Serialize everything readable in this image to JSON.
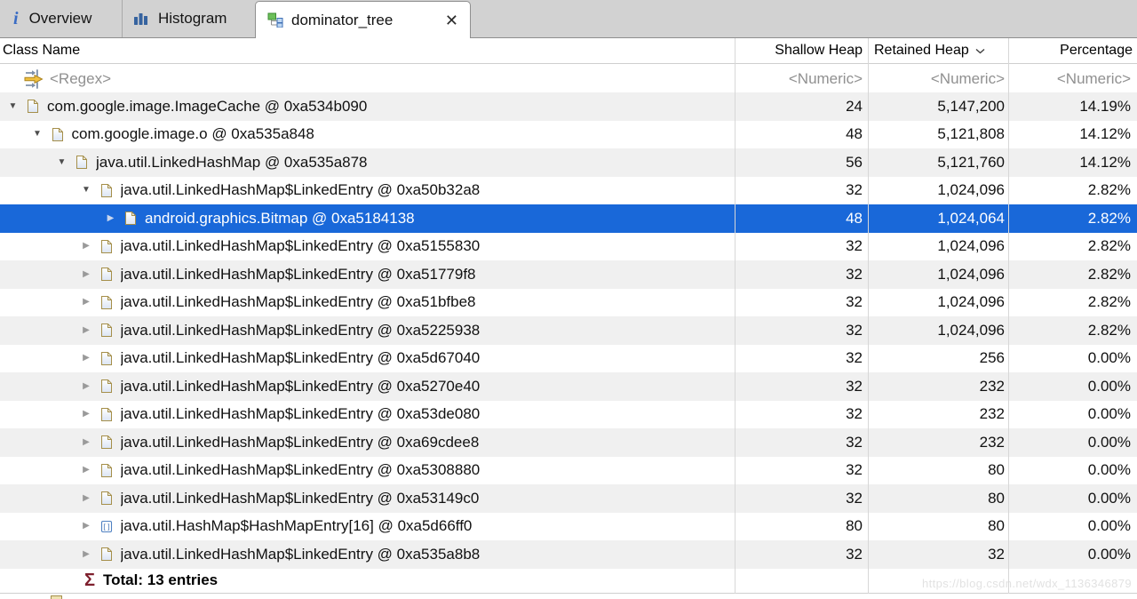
{
  "tabs": {
    "overview": {
      "label": "Overview"
    },
    "histogram": {
      "label": "Histogram"
    },
    "dominator": {
      "label": "dominator_tree"
    }
  },
  "table": {
    "columns": {
      "class_name": "Class Name",
      "shallow": "Shallow Heap",
      "retained": "Retained Heap",
      "percentage": "Percentage",
      "sorted_by": "retained"
    },
    "filter": {
      "class_name": "<Regex>",
      "numeric": "<Numeric>"
    },
    "rows": [
      {
        "level": 0,
        "state": "expanded",
        "icon": "object-instance-icon",
        "label": "com.google.image.ImageCache @ 0xa534b090",
        "shallow": "24",
        "retained": "5,147,200",
        "percentage": "14.19%",
        "selected": false
      },
      {
        "level": 1,
        "state": "expanded",
        "icon": "object-instance-icon",
        "label": "com.google.image.o @ 0xa535a848",
        "shallow": "48",
        "retained": "5,121,808",
        "percentage": "14.12%",
        "selected": false
      },
      {
        "level": 2,
        "state": "expanded",
        "icon": "object-instance-icon",
        "label": "java.util.LinkedHashMap @ 0xa535a878",
        "shallow": "56",
        "retained": "5,121,760",
        "percentage": "14.12%",
        "selected": false
      },
      {
        "level": 3,
        "state": "expanded",
        "icon": "object-instance-icon",
        "label": "java.util.LinkedHashMap$LinkedEntry @ 0xa50b32a8",
        "shallow": "32",
        "retained": "1,024,096",
        "percentage": "2.82%",
        "selected": false
      },
      {
        "level": 4,
        "state": "collapsed",
        "icon": "object-instance-icon",
        "label": "android.graphics.Bitmap @ 0xa5184138",
        "shallow": "48",
        "retained": "1,024,064",
        "percentage": "2.82%",
        "selected": true
      },
      {
        "level": 3,
        "state": "collapsed",
        "icon": "object-instance-icon",
        "label": "java.util.LinkedHashMap$LinkedEntry @ 0xa5155830",
        "shallow": "32",
        "retained": "1,024,096",
        "percentage": "2.82%",
        "selected": false
      },
      {
        "level": 3,
        "state": "collapsed",
        "icon": "object-instance-icon",
        "label": "java.util.LinkedHashMap$LinkedEntry @ 0xa51779f8",
        "shallow": "32",
        "retained": "1,024,096",
        "percentage": "2.82%",
        "selected": false
      },
      {
        "level": 3,
        "state": "collapsed",
        "icon": "object-instance-icon",
        "label": "java.util.LinkedHashMap$LinkedEntry @ 0xa51bfbe8",
        "shallow": "32",
        "retained": "1,024,096",
        "percentage": "2.82%",
        "selected": false
      },
      {
        "level": 3,
        "state": "collapsed",
        "icon": "object-instance-icon",
        "label": "java.util.LinkedHashMap$LinkedEntry @ 0xa5225938",
        "shallow": "32",
        "retained": "1,024,096",
        "percentage": "2.82%",
        "selected": false
      },
      {
        "level": 3,
        "state": "collapsed",
        "icon": "object-instance-icon",
        "label": "java.util.LinkedHashMap$LinkedEntry @ 0xa5d67040",
        "shallow": "32",
        "retained": "256",
        "percentage": "0.00%",
        "selected": false
      },
      {
        "level": 3,
        "state": "collapsed",
        "icon": "object-instance-icon",
        "label": "java.util.LinkedHashMap$LinkedEntry @ 0xa5270e40",
        "shallow": "32",
        "retained": "232",
        "percentage": "0.00%",
        "selected": false
      },
      {
        "level": 3,
        "state": "collapsed",
        "icon": "object-instance-icon",
        "label": "java.util.LinkedHashMap$LinkedEntry @ 0xa53de080",
        "shallow": "32",
        "retained": "232",
        "percentage": "0.00%",
        "selected": false
      },
      {
        "level": 3,
        "state": "collapsed",
        "icon": "object-instance-icon",
        "label": "java.util.LinkedHashMap$LinkedEntry @ 0xa69cdee8",
        "shallow": "32",
        "retained": "232",
        "percentage": "0.00%",
        "selected": false
      },
      {
        "level": 3,
        "state": "collapsed",
        "icon": "object-instance-icon",
        "label": "java.util.LinkedHashMap$LinkedEntry @ 0xa5308880",
        "shallow": "32",
        "retained": "80",
        "percentage": "0.00%",
        "selected": false
      },
      {
        "level": 3,
        "state": "collapsed",
        "icon": "object-instance-icon",
        "label": "java.util.LinkedHashMap$LinkedEntry @ 0xa53149c0",
        "shallow": "32",
        "retained": "80",
        "percentage": "0.00%",
        "selected": false
      },
      {
        "level": 3,
        "state": "collapsed",
        "icon": "array-instance-icon",
        "label": "java.util.HashMap$HashMapEntry[16] @ 0xa5d66ff0",
        "shallow": "80",
        "retained": "80",
        "percentage": "0.00%",
        "selected": false
      },
      {
        "level": 3,
        "state": "collapsed",
        "icon": "object-instance-icon",
        "label": "java.util.LinkedHashMap$LinkedEntry @ 0xa535a8b8",
        "shallow": "32",
        "retained": "32",
        "percentage": "0.00%",
        "selected": false
      }
    ],
    "total_sigma": "Σ",
    "total_label": "Total: 13 entries"
  },
  "watermark": "https://blog.csdn.net/wdx_1136346879",
  "colors": {
    "selection_blue": "#1968d9",
    "alt_row_gray": "#f0f0f0",
    "tab_bar_gray": "#d2d2d2",
    "icon_border_tan": "#a58f4a",
    "filter_arrow_gold": "#f0c040"
  }
}
